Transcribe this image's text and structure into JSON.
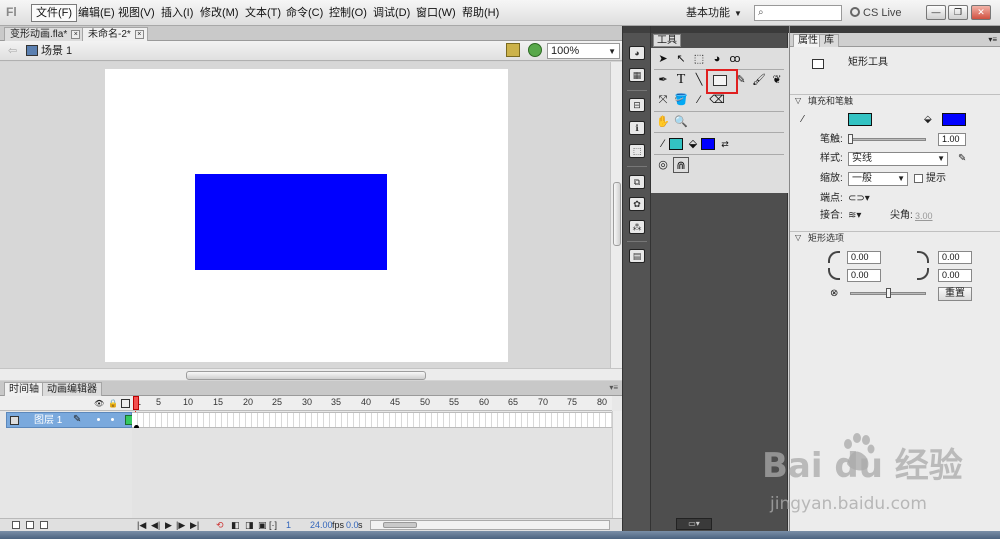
{
  "menubar": {
    "logo": "Fl",
    "items": [
      {
        "label": "文件(F)"
      },
      {
        "label": "编辑(E)"
      },
      {
        "label": "视图(V)"
      },
      {
        "label": "插入(I)"
      },
      {
        "label": "修改(M)"
      },
      {
        "label": "文本(T)"
      },
      {
        "label": "命令(C)"
      },
      {
        "label": "控制(O)"
      },
      {
        "label": "调试(D)"
      },
      {
        "label": "窗口(W)"
      },
      {
        "label": "帮助(H)"
      }
    ],
    "workspace": "基本功能",
    "search_placeholder": "",
    "cs_live": "CS Live",
    "window_buttons": {
      "minimize": "—",
      "restore": "❐",
      "close": "✕"
    }
  },
  "doc_tabs": [
    {
      "label": "变形动画.fla*",
      "active": false
    },
    {
      "label": "未命名-2*",
      "active": true
    }
  ],
  "editbar": {
    "back_arrow": "⇦",
    "scene_label": "场景 1",
    "zoom": "100%"
  },
  "stage": {
    "background": "#ffffff",
    "shape_fill": "#0000ff"
  },
  "timeline": {
    "tabs": [
      {
        "label": "时间轴",
        "active": true
      },
      {
        "label": "动画编辑器",
        "active": false
      }
    ],
    "frame_numbers": [
      "1",
      "5",
      "10",
      "15",
      "20",
      "25",
      "30",
      "35",
      "40",
      "45",
      "50",
      "55",
      "60",
      "65",
      "70",
      "75",
      "80"
    ],
    "layers": [
      {
        "name": "图层 1",
        "selected": true
      }
    ],
    "footer": {
      "current_frame": "1",
      "fps": "24.00",
      "fps_unit": "fps",
      "elapsed": "0.0",
      "elapsed_unit": "s"
    }
  },
  "tools_panel": {
    "title": "工具",
    "stroke_color": "#33c3c3",
    "fill_color": "#0000ff"
  },
  "properties_panel": {
    "tabs": [
      {
        "label": "属性",
        "active": true
      },
      {
        "label": "库",
        "active": false
      }
    ],
    "tool_name": "矩形工具",
    "sections": {
      "fill_stroke": "填充和笔触",
      "rect_options": "矩形选项"
    },
    "stroke_color": "#33c3c3",
    "fill_color": "#0000ff",
    "stroke_label": "笔触:",
    "stroke_value": "1.00",
    "style_label": "样式:",
    "style_value": "实线",
    "scale_label": "缩放:",
    "scale_value": "一般",
    "hint_label": "提示",
    "cap_label": "端点:",
    "join_label": "接合:",
    "miter_label": "尖角:",
    "miter_value": "3.00",
    "corner_values": [
      "0.00",
      "0.00",
      "0.00",
      "0.00"
    ],
    "reset_label": "重置"
  },
  "watermark": {
    "logo": "Bai du 经验",
    "url": "jingyan.baidu.com"
  }
}
